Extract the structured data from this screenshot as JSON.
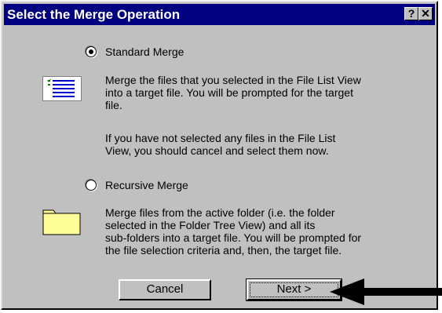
{
  "window": {
    "title": "Select the Merge Operation",
    "help_label": "?",
    "close_label": "✕"
  },
  "standard": {
    "label": "Standard Merge",
    "selected": true,
    "description_lines": [
      "Merge the files that you selected in the File List View",
      "into a target file.  You will be prompted for the target",
      "file."
    ],
    "note_lines": [
      "If you have not selected any files in the File List",
      "View, you should cancel and select them now."
    ]
  },
  "recursive": {
    "label": "Recursive Merge",
    "selected": false,
    "description_lines": [
      "Merge files from the active folder (i.e. the folder",
      "selected in the Folder Tree View) and all its",
      "sub-folders into a target file.  You will be prompted for",
      "the file selection criteria and, then, the target file."
    ]
  },
  "buttons": {
    "cancel": "Cancel",
    "next": "Next >"
  },
  "icons": {
    "standard": "document-list-icon",
    "recursive": "folder-icon",
    "pointer": "arrow-pointer-icon"
  },
  "colors": {
    "titlebar": "#000080",
    "dialog": "#c0c0c0",
    "folder": "#ffff99",
    "list_lines": "#0000cc"
  }
}
